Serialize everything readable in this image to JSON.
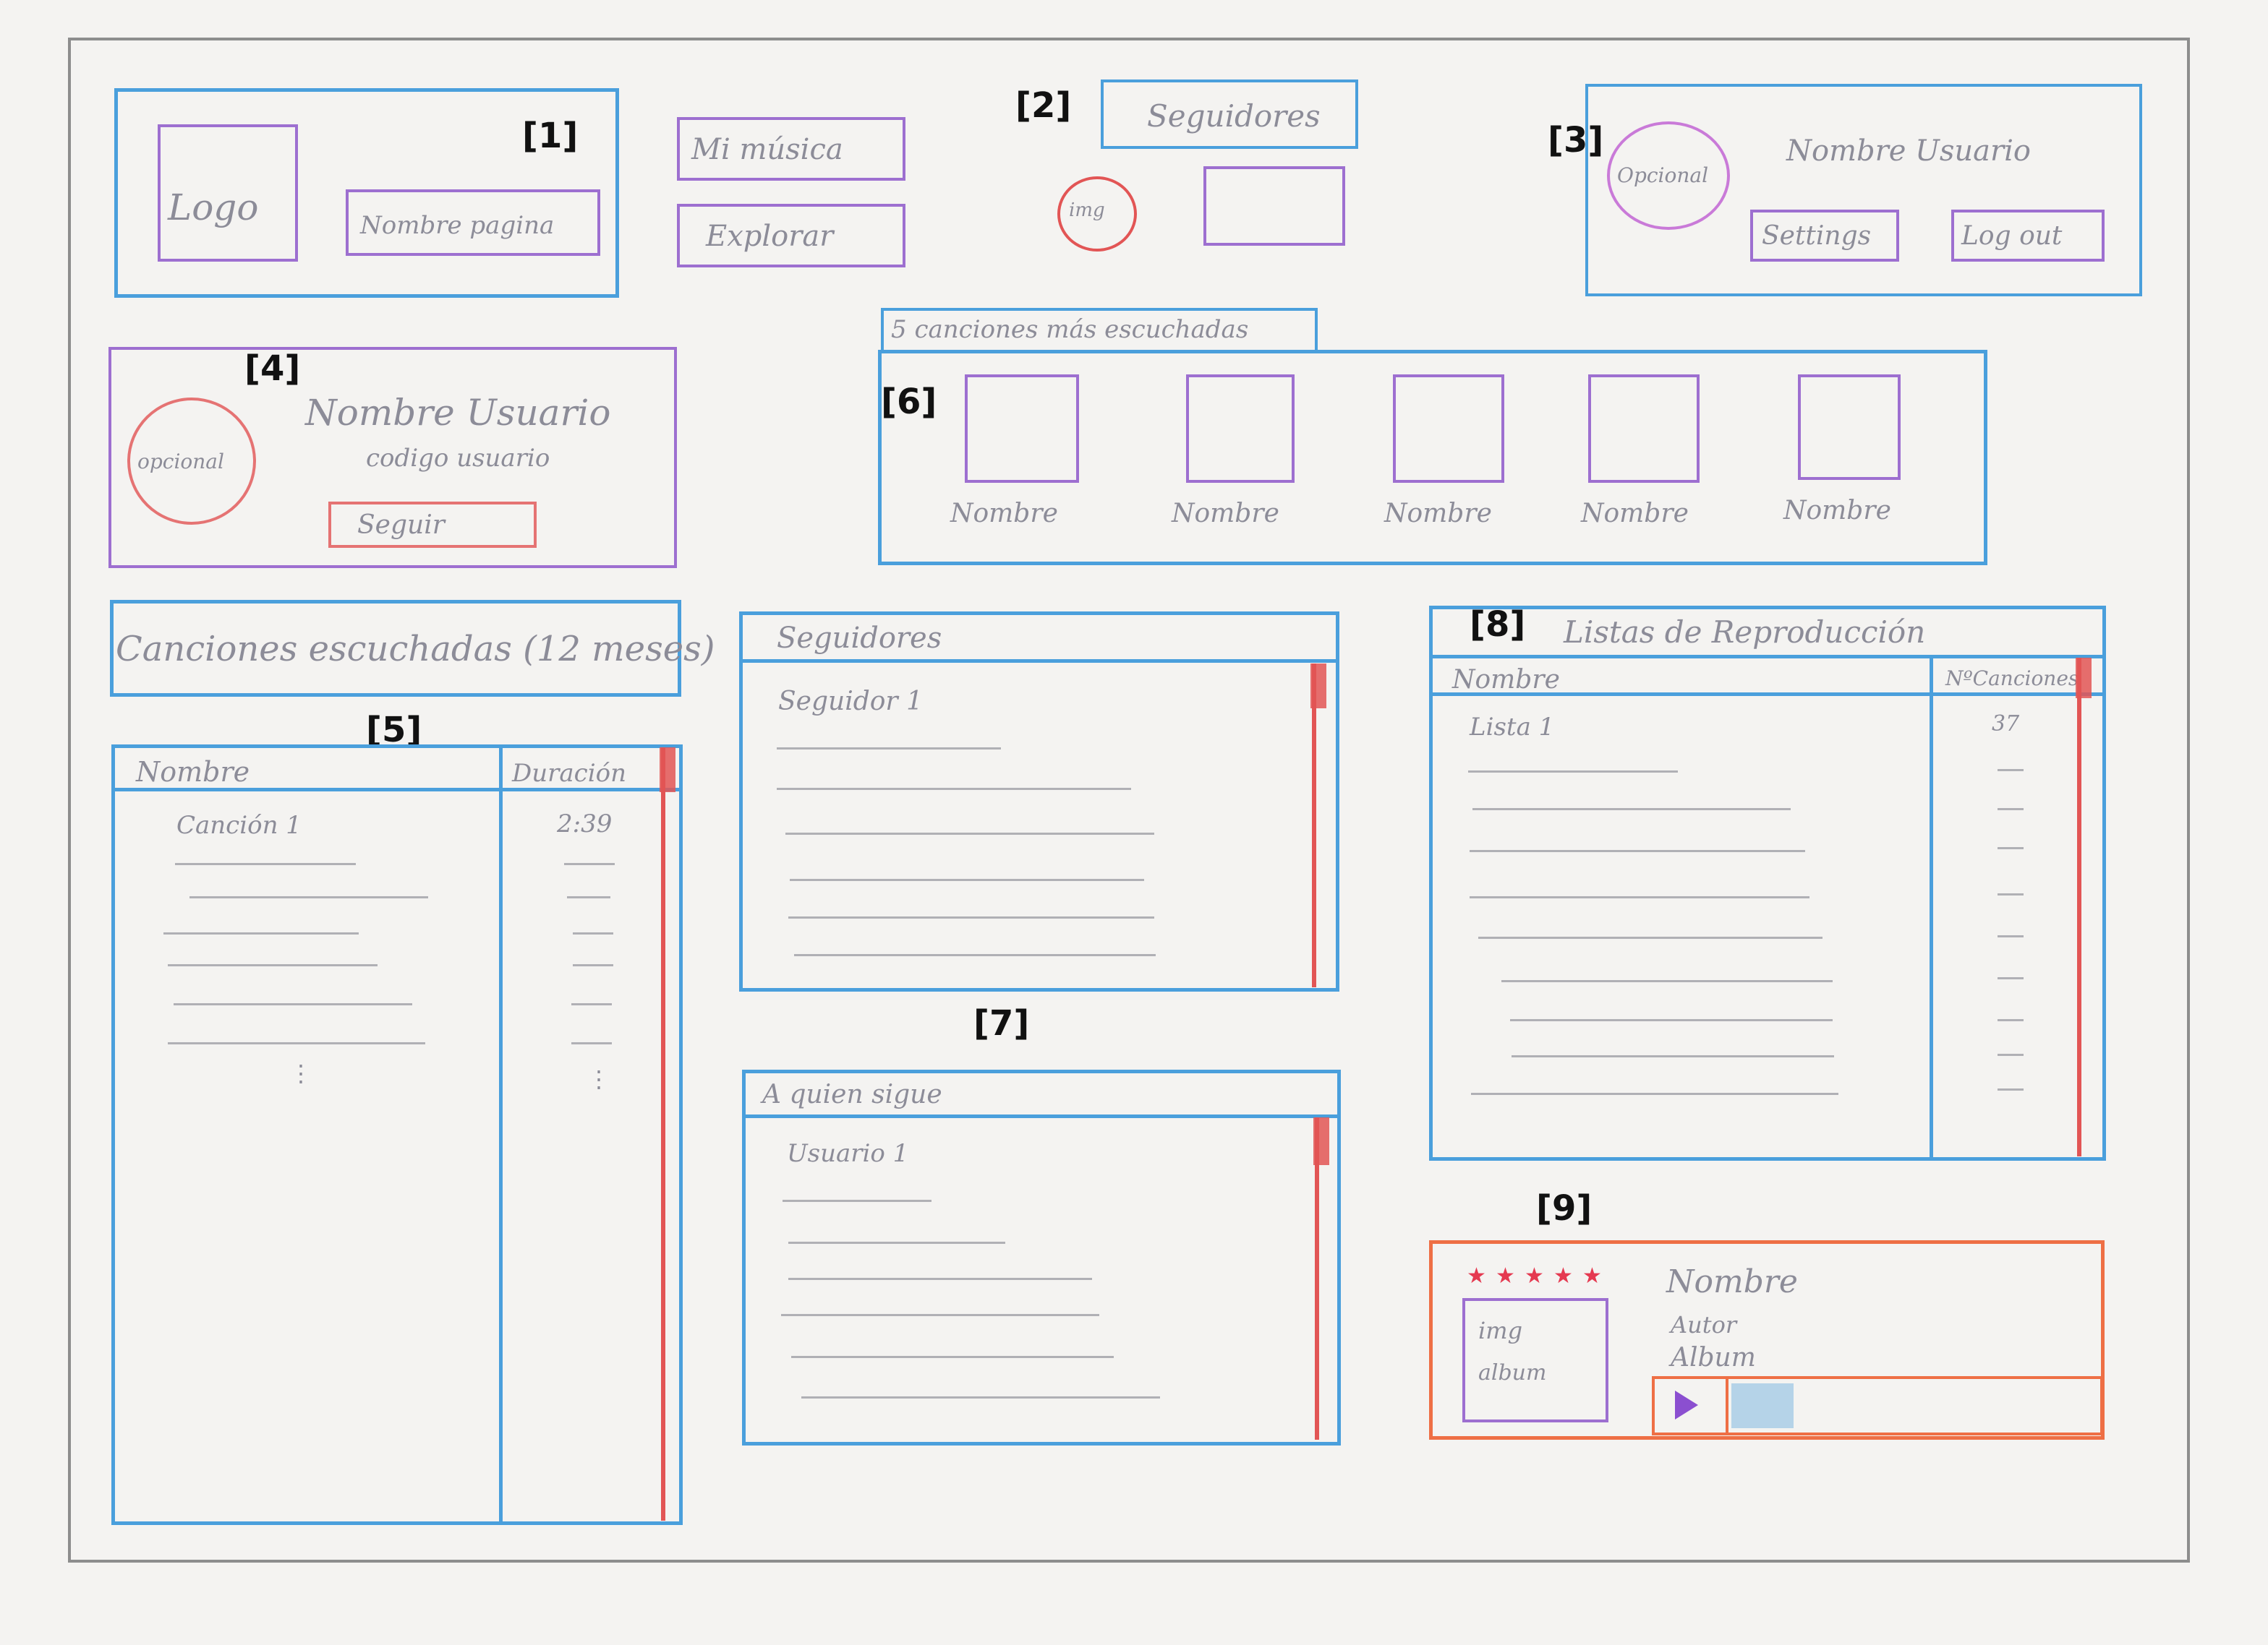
{
  "tags": [
    "[1]",
    "[2]",
    "[3]",
    "[4]",
    "[5]",
    "[6]",
    "[7]",
    "[8]",
    "[9]"
  ],
  "header": {
    "logo": "Logo",
    "page_name": "Nombre pagina",
    "nav": [
      "Mi música",
      "Explorar"
    ],
    "followers_label": "Seguidores",
    "img": "img",
    "user": {
      "optional": "Opcional",
      "name": "Nombre Usuario",
      "settings": "Settings",
      "logout": "Log out"
    }
  },
  "profile": {
    "optional": "opcional",
    "name": "Nombre Usuario",
    "code": "codigo usuario",
    "follow": "Seguir"
  },
  "top5": {
    "title": "5 canciones más escuchadas",
    "names": [
      "Nombre",
      "Nombre",
      "Nombre",
      "Nombre",
      "Nombre"
    ]
  },
  "songs": {
    "title": "Canciones escuchadas (12 meses)",
    "col_name": "Nombre",
    "col_duration": "Duración",
    "first_song": "Canción 1",
    "first_duration": "2:39"
  },
  "followers": {
    "title": "Seguidores",
    "first": "Seguidor 1"
  },
  "following": {
    "title": "A quien sigue",
    "first": "Usuario 1"
  },
  "playlists": {
    "title": "Listas de Reproducción",
    "col_name": "Nombre",
    "col_count": "NºCanciones",
    "first": "Lista 1",
    "first_count": "37"
  },
  "player": {
    "stars": 5,
    "img": "img",
    "album_lbl": "album",
    "name": "Nombre",
    "author": "Autor",
    "album": "Album"
  },
  "colors": {
    "blue": "#4a9fdc",
    "purple": "#9d6fd0",
    "red": "#e57373",
    "orange": "#ee6f45"
  }
}
